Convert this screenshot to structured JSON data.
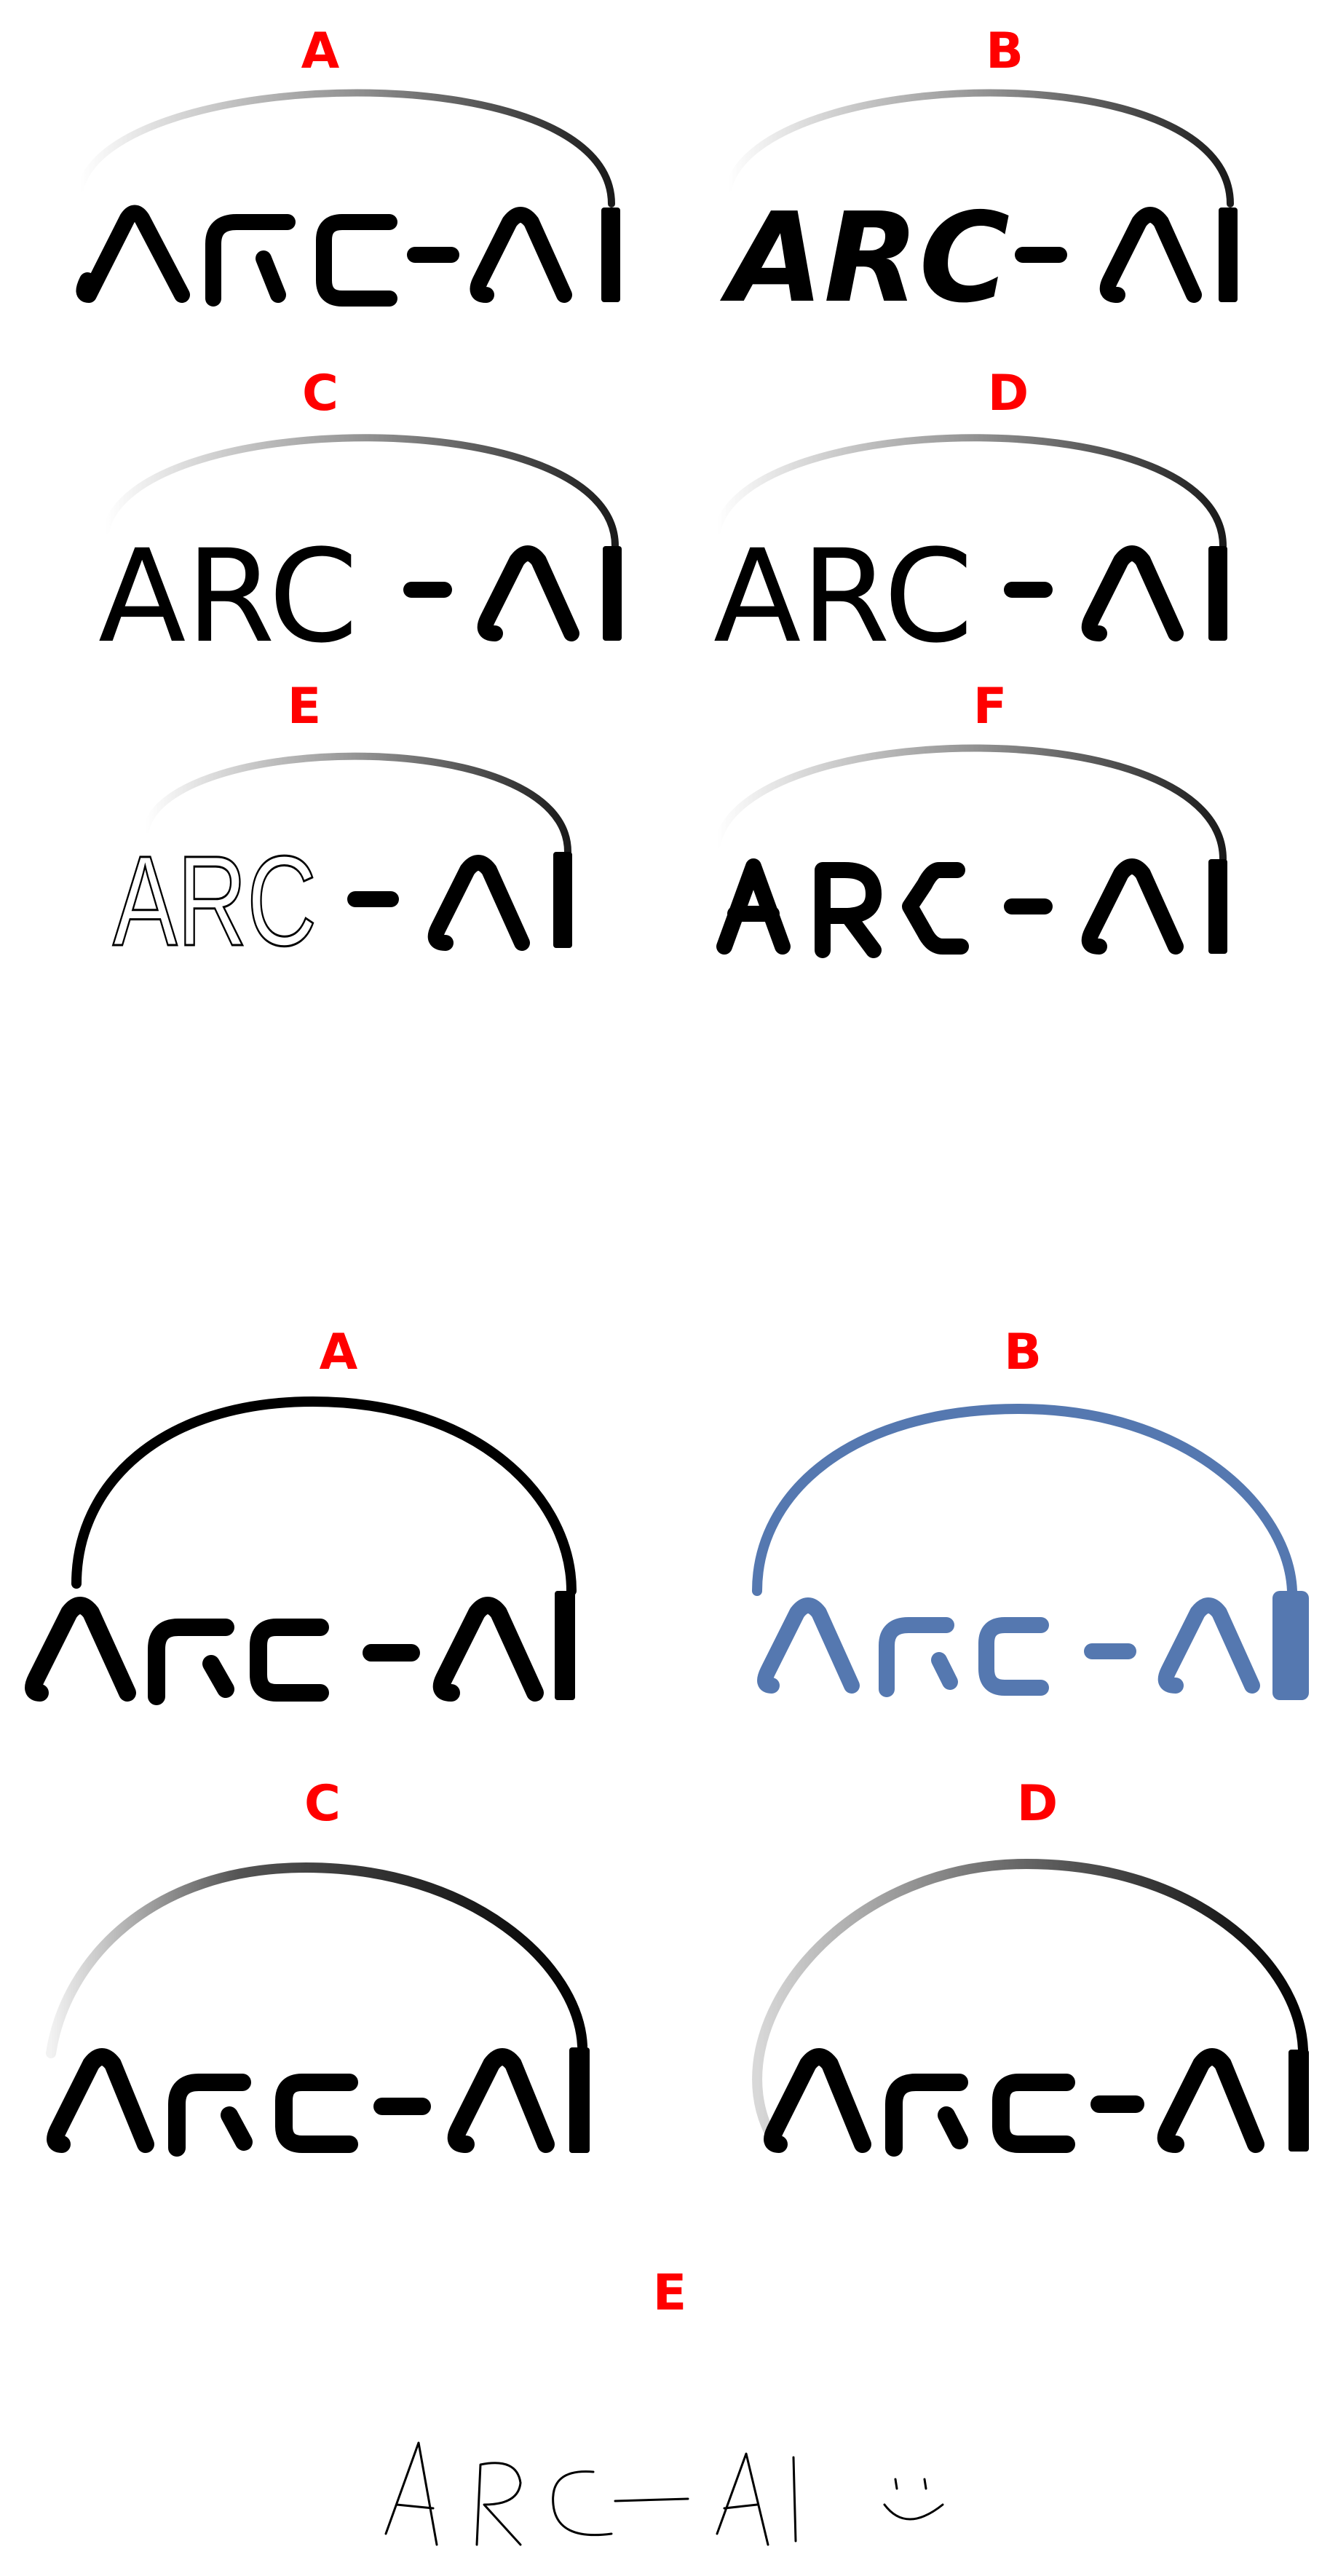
{
  "wordmark": "ARC-AI",
  "colors": {
    "label": "#ff0000",
    "ink": "#000000",
    "blue_variant": "#5578b0",
    "gradient_light": "#e6e6e6",
    "gradient_dark": "#1a1a1a"
  },
  "set_one": {
    "labels": [
      "A",
      "B",
      "C",
      "D",
      "E",
      "F"
    ],
    "word": "ARC",
    "dash": "-"
  },
  "set_two": {
    "labels": [
      "A",
      "B",
      "C",
      "D",
      "E"
    ],
    "sketch_text": "ARC-AI",
    "sketch_face": "smiley-face"
  }
}
